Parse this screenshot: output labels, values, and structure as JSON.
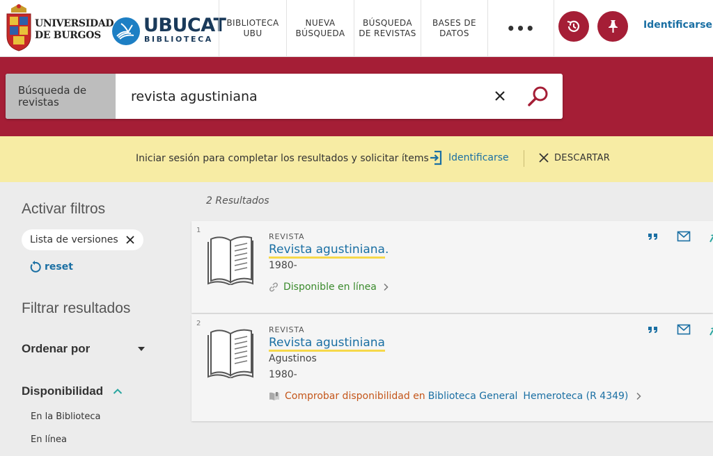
{
  "header": {
    "university_line1": "UNIVERSIDAD",
    "university_line2": "DE BURGOS",
    "brand_title": "UBUCAT",
    "brand_subtitle": "BIBLIOTECA",
    "nav": [
      {
        "label": "BIBLIOTECA\nUBU"
      },
      {
        "label": "NUEVA\nBÚSQUEDA"
      },
      {
        "label": "BÚSQUEDA\nDE REVISTAS"
      },
      {
        "label": "BASES DE\nDATOS"
      },
      {
        "label": "•••"
      }
    ],
    "login": "Identificarse",
    "accent": "#a51e36"
  },
  "search": {
    "scope": "Búsqueda de revistas",
    "query": "revista agustiniana"
  },
  "notice": {
    "text": "Iniciar sesión para completar los resultados y solicitar ítems",
    "login": "Identificarse",
    "dismiss": "DESCARTAR"
  },
  "sidebar": {
    "active_filters_title": "Activar filtros",
    "chip": "Lista de versiones",
    "reset": "reset",
    "filter_title": "Filtrar resultados",
    "sort_label": "Ordenar por",
    "availability_label": "Disponibilidad",
    "availability_options": [
      "En la Biblioteca",
      "En línea"
    ]
  },
  "results": {
    "count": "2 Resultados",
    "items": [
      {
        "num": "1",
        "type": "REVISTA",
        "title": "Revista agustiniana",
        "title_suffix": ".",
        "lines": [
          "1980-"
        ],
        "availability": "Disponible en línea",
        "availability_color": "#3a8a2c"
      },
      {
        "num": "2",
        "type": "REVISTA",
        "title": "Revista agustiniana",
        "title_suffix": "",
        "lines": [
          "Agustinos",
          "1980-"
        ],
        "availability_prefix": "Comprobar disponibilidad en",
        "availability_location": "Biblioteca General",
        "availability_shelf": "Hemeroteca (R 4349)",
        "availability_color": "#c4561a"
      }
    ]
  }
}
